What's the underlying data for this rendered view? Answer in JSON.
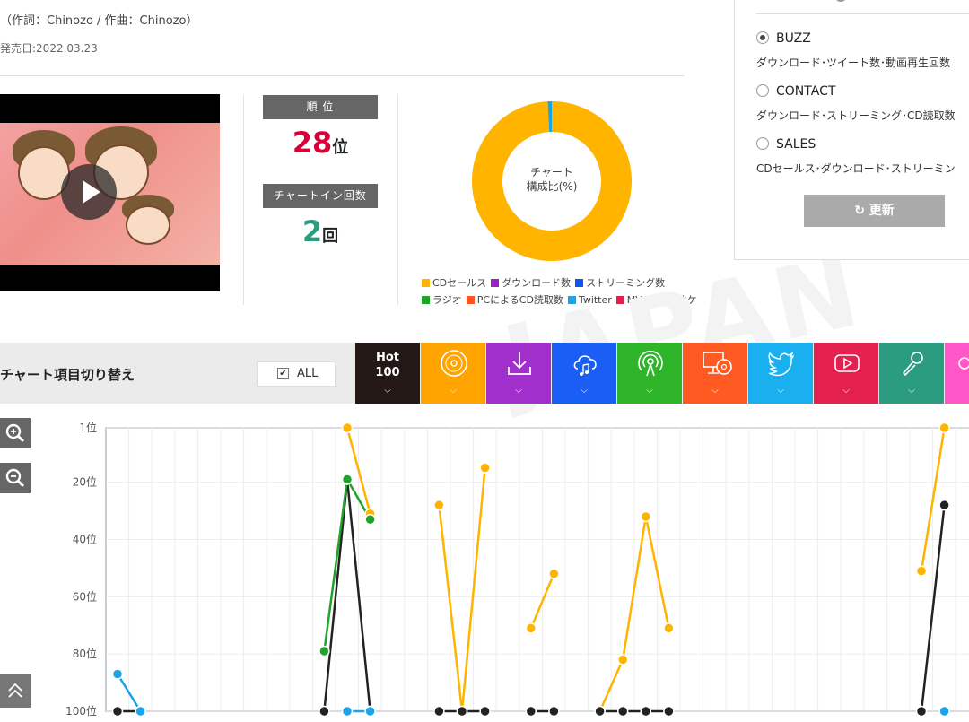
{
  "song": {
    "credit": "（作詞：Chinozo / 作曲：Chinozo）",
    "release": "発売日:2022.03.23"
  },
  "stats": {
    "rank_label": "順 位",
    "rank_value": "28",
    "rank_unit": "位",
    "chartin_label": "チャートイン回数",
    "chartin_value": "2",
    "chartin_unit": "回",
    "rank_color": "#d9003a",
    "chartin_color": "#2b9c80"
  },
  "donut": {
    "center_line1": "チャート",
    "center_line2": "構成比(%)",
    "slices": [
      {
        "name": "CDセールス",
        "value": 99.2,
        "color": "#ffb400"
      },
      {
        "name": "Twitter",
        "value": 0.8,
        "color": "#1aa3e6"
      }
    ]
  },
  "legend": {
    "row1": [
      {
        "label": "CDセールス",
        "color": "#ffb400"
      },
      {
        "label": "ダウンロード数",
        "color": "#9b1fc7"
      },
      {
        "label": "ストリーミング数",
        "color": "#1156f5"
      }
    ],
    "row2": [
      {
        "label": "ラジオ",
        "color": "#1fa32b"
      },
      {
        "label": "PCによるCD読取数",
        "color": "#ff5522"
      },
      {
        "label": "Twitter",
        "color": "#1aa3e6"
      },
      {
        "label": "MV",
        "color": "#e0204d"
      },
      {
        "label": "カラオケ",
        "color": "#2b9c80"
      }
    ]
  },
  "panel": {
    "options": [
      {
        "label": "BUZZ",
        "desc": "ダウンロード･ツイート数･動画再生回数",
        "selected": true
      },
      {
        "label": "CONTACT",
        "desc": "ダウンロード･ストリーミング･CD読取数",
        "selected": false
      },
      {
        "label": "SALES",
        "desc": "CDセールス･ダウンロード･ストリーミン",
        "selected": false
      }
    ],
    "refresh_label": "更新"
  },
  "watermark": "JAPAN",
  "toolbar": {
    "title": "チャート項目切り替え",
    "all_label": "ALL",
    "hot_label_1": "Hot",
    "hot_label_2": "100",
    "categories": [
      {
        "icon": "cd-icon",
        "color": "#ffa400"
      },
      {
        "icon": "download-icon",
        "color": "#a12fcc"
      },
      {
        "icon": "streaming-cloud-icon",
        "color": "#1a5ef5"
      },
      {
        "icon": "radio-icon",
        "color": "#2fb52a"
      },
      {
        "icon": "pc-cd-icon",
        "color": "#ff5a22"
      },
      {
        "icon": "twitter-icon",
        "color": "#1ab0ef"
      },
      {
        "icon": "youtube-icon",
        "color": "#e3204e"
      },
      {
        "icon": "karaoke-mic-icon",
        "color": "#2b9c80"
      },
      {
        "icon": "more-icon",
        "color": "#ff57c8"
      }
    ]
  },
  "chart_data": {
    "type": "line",
    "y_tick_labels": [
      "1位",
      "20位",
      "40位",
      "60位",
      "80位",
      "100位"
    ],
    "y_ticks": [
      1,
      20,
      40,
      60,
      80,
      100
    ],
    "ylim": [
      1,
      100
    ],
    "y_inverted": true,
    "grid": true,
    "weeks": 37,
    "series": [
      {
        "color": "#ffb400",
        "segments": [
          [
            [
              10,
              1
            ],
            [
              11,
              31
            ]
          ],
          [
            [
              14,
              28
            ],
            [
              15,
              100
            ],
            [
              16,
              15
            ]
          ],
          [
            [
              18,
              71
            ],
            [
              19,
              52
            ]
          ],
          [
            [
              21,
              100
            ],
            [
              22,
              82
            ],
            [
              23,
              32
            ],
            [
              24,
              71
            ]
          ],
          [
            [
              35,
              51
            ],
            [
              36,
              1
            ]
          ]
        ]
      },
      {
        "color": "#222222",
        "segments": [
          [
            [
              0,
              100
            ],
            [
              1,
              100
            ]
          ],
          [
            [
              9,
              100
            ],
            [
              10,
              19
            ],
            [
              11,
              100
            ]
          ],
          [
            [
              14,
              100
            ],
            [
              15,
              100
            ],
            [
              16,
              100
            ]
          ],
          [
            [
              18,
              100
            ],
            [
              19,
              100
            ]
          ],
          [
            [
              21,
              100
            ],
            [
              22,
              100
            ],
            [
              23,
              100
            ],
            [
              24,
              100
            ]
          ],
          [
            [
              35,
              100
            ],
            [
              36,
              28
            ]
          ]
        ]
      },
      {
        "color": "#1fa32b",
        "segments": [
          [
            [
              9,
              79
            ],
            [
              10,
              19
            ],
            [
              11,
              33
            ]
          ]
        ]
      },
      {
        "color": "#1aa3e6",
        "segments": [
          [
            [
              0,
              87
            ],
            [
              1,
              100
            ]
          ],
          [
            [
              10,
              100
            ],
            [
              11,
              100
            ]
          ],
          [
            [
              36,
              100
            ]
          ]
        ]
      }
    ]
  }
}
